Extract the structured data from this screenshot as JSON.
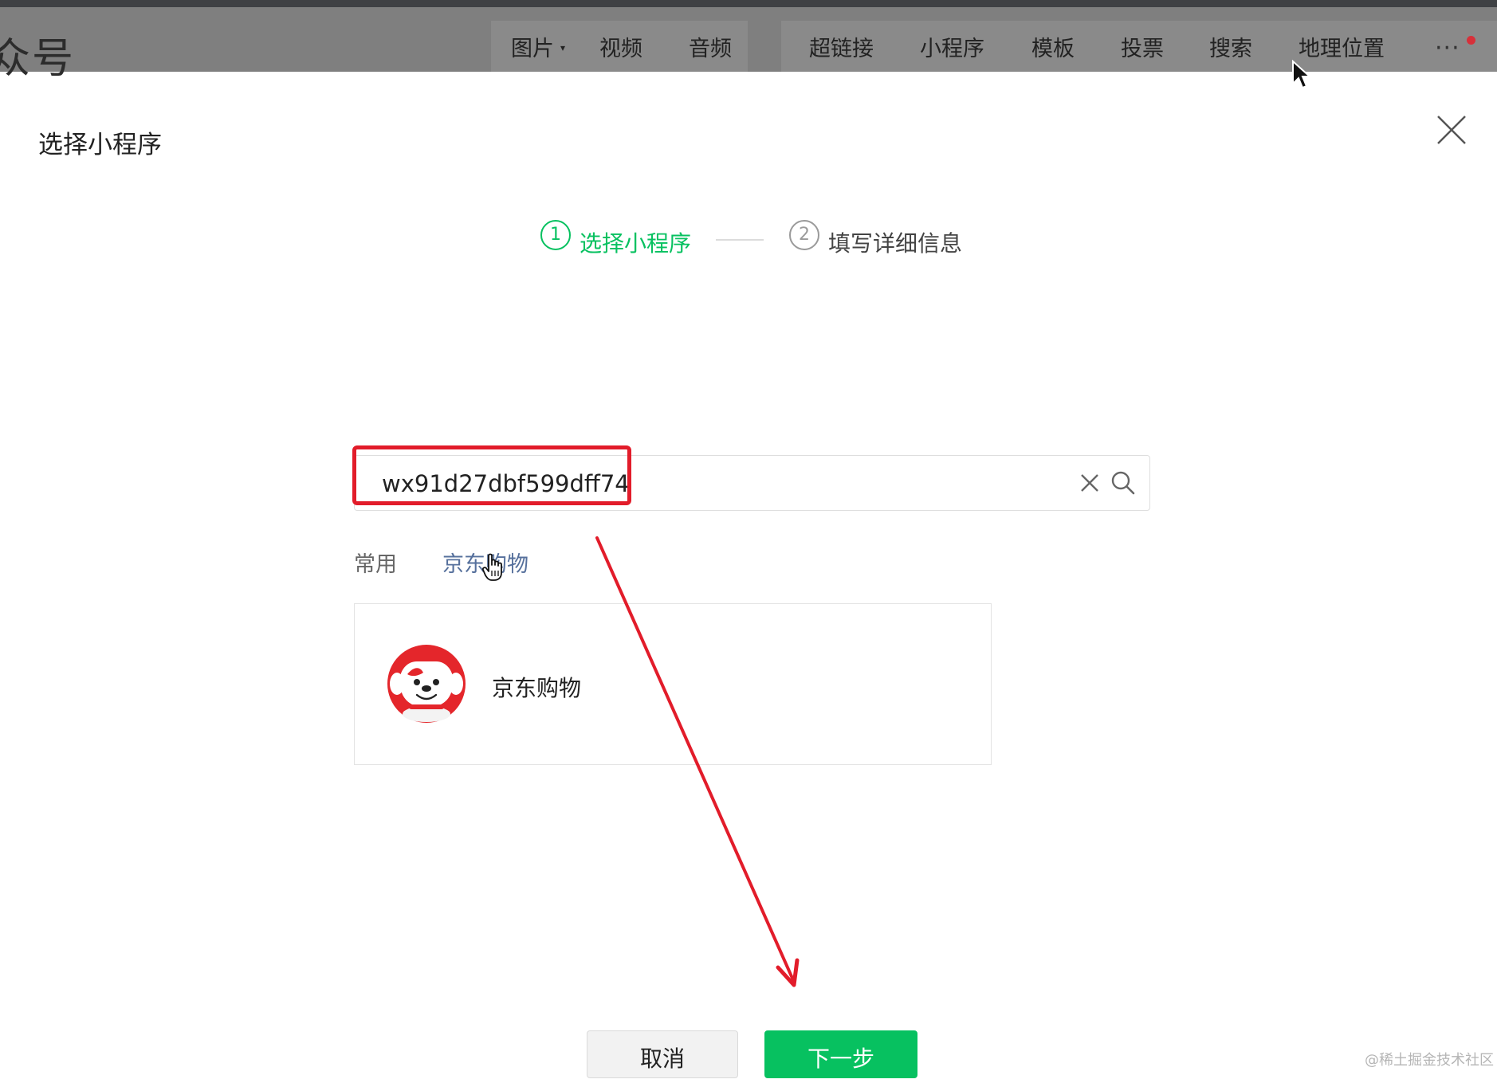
{
  "toolbar": {
    "brand_fragment": "众号",
    "items": [
      {
        "label": "图片",
        "has_caret": true
      },
      {
        "label": "视频"
      },
      {
        "label": "音频"
      },
      {
        "label": "超链接"
      },
      {
        "label": "小程序"
      },
      {
        "label": "模板"
      },
      {
        "label": "投票"
      },
      {
        "label": "搜索"
      },
      {
        "label": "地理位置"
      }
    ],
    "more_label": "···",
    "caret": "▾"
  },
  "dialog": {
    "title": "选择小程序",
    "steps": [
      {
        "number": "1",
        "label": "选择小程序",
        "state": "active"
      },
      {
        "number": "2",
        "label": "填写详细信息",
        "state": "inactive"
      }
    ]
  },
  "search": {
    "value": "wx91d27dbf599dff74",
    "placeholder": ""
  },
  "tabs": [
    {
      "label": "常用",
      "selected": false
    },
    {
      "label": "京东购物",
      "selected": true
    }
  ],
  "results": [
    {
      "name": "京东购物",
      "icon": "jd-mascot-avatar"
    }
  ],
  "footer": {
    "cancel_label": "取消",
    "next_label": "下一步"
  },
  "watermark": "@稀土掘金技术社区",
  "colors": {
    "accent_green": "#07c160",
    "annotation_red": "#e21c2a",
    "toolbar_gray": "#7f7f7f",
    "tab_link_blue": "#56709c"
  }
}
